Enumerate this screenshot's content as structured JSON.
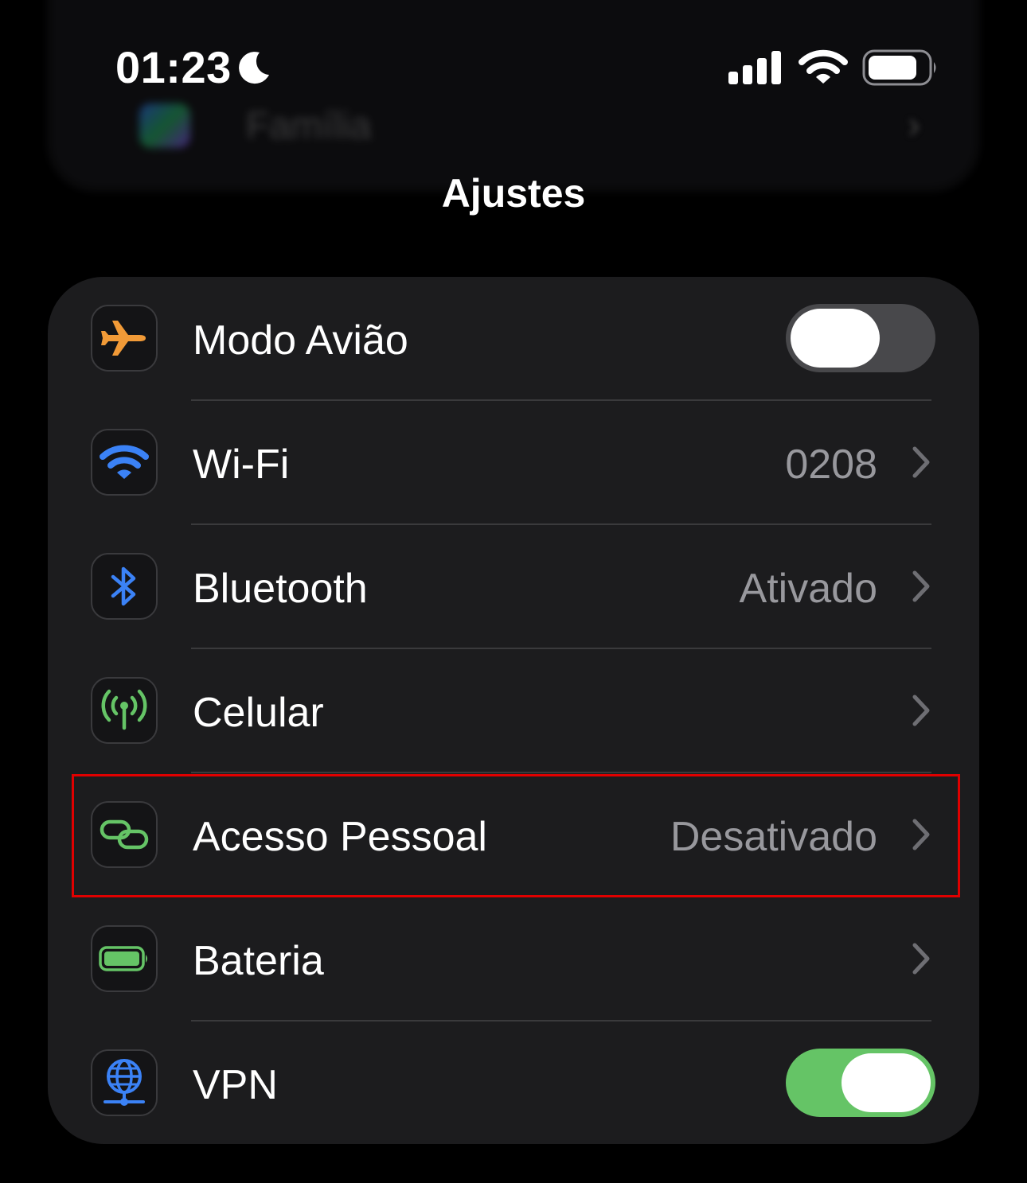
{
  "status_bar": {
    "time": "01:23",
    "icons": [
      "moon-icon",
      "cellular-signal-icon",
      "wifi-icon",
      "battery-icon"
    ]
  },
  "background": {
    "ghost_label": "Família"
  },
  "header": {
    "title": "Ajustes"
  },
  "colors": {
    "background": "#000000",
    "group": "#1c1c1e",
    "toggle_on": "#65c466",
    "toggle_off": "#48484b",
    "highlight": "#e00000",
    "airplane_orange": "#f19a37",
    "wifi_blue": "#3b82f6",
    "green": "#65c466"
  },
  "settings": [
    {
      "label": "Modo Avião",
      "icon": "airplane-icon",
      "control": "toggle",
      "on": false
    },
    {
      "label": "Wi-Fi",
      "icon": "wifi-icon",
      "value": "0208",
      "control": "chevron"
    },
    {
      "label": "Bluetooth",
      "icon": "bluetooth-icon",
      "value": "Ativado",
      "control": "chevron"
    },
    {
      "label": "Celular",
      "icon": "antenna-icon",
      "value": "",
      "control": "chevron"
    },
    {
      "label": "Acesso Pessoal",
      "icon": "link-icon",
      "value": "Desativado",
      "control": "chevron",
      "highlighted": true
    },
    {
      "label": "Bateria",
      "icon": "battery-icon",
      "value": "",
      "control": "chevron"
    },
    {
      "label": "VPN",
      "icon": "globe-network-icon",
      "control": "toggle",
      "on": true
    }
  ]
}
